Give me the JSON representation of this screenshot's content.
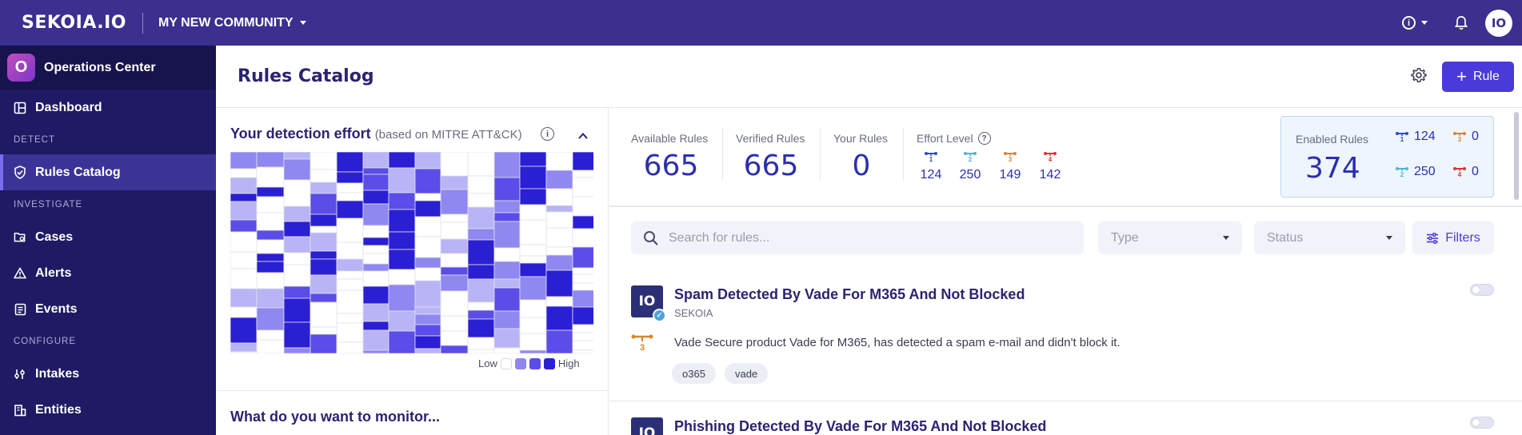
{
  "topbar": {
    "brand": "SEKOIA.IO",
    "community": "MY NEW COMMUNITY",
    "avatar_initials": "IO"
  },
  "sidebar": {
    "app_name": "Operations Center",
    "app_logo_letter": "O",
    "dashboard": "Dashboard",
    "section_detect": "DETECT",
    "rules_catalog": "Rules Catalog",
    "section_investigate": "INVESTIGATE",
    "cases": "Cases",
    "alerts": "Alerts",
    "events": "Events",
    "section_configure": "CONFIGURE",
    "intakes": "Intakes",
    "entities": "Entities"
  },
  "header": {
    "title": "Rules Catalog",
    "add_rule_label": "Rule"
  },
  "effort_panel": {
    "title": "Your detection effort",
    "subtitle": "(based on MITRE ATT&CK)",
    "legend_low": "Low",
    "legend_high": "High",
    "legend_colors": [
      "#ffffff",
      "#8f88f0",
      "#5a4de8",
      "#2a1fd3"
    ],
    "monitor_title": "What do you want to monitor..."
  },
  "stats": {
    "available_label": "Available Rules",
    "available_value": "665",
    "verified_label": "Verified Rules",
    "verified_value": "665",
    "your_label": "Your Rules",
    "your_value": "0",
    "effort_label": "Effort Level",
    "effort_levels": [
      {
        "level": "1",
        "count": "124",
        "color": "#2f4fb8"
      },
      {
        "level": "2",
        "count": "250",
        "color": "#4fb3d9"
      },
      {
        "level": "3",
        "count": "149",
        "color": "#d9862e"
      },
      {
        "level": "4",
        "count": "142",
        "color": "#d93636"
      }
    ],
    "enabled_label": "Enabled Rules",
    "enabled_value": "374",
    "enabled_breakdown": {
      "l1": "124",
      "l3": "0",
      "l2": "250",
      "l4": "0"
    }
  },
  "filters": {
    "search_placeholder": "Search for rules...",
    "type_placeholder": "Type",
    "status_placeholder": "Status",
    "filters_label": "Filters"
  },
  "rules": [
    {
      "name": "Spam Detected By Vade For M365 And Not Blocked",
      "vendor": "SEKOIA",
      "effort": "3",
      "description": "Vade Secure product Vade for M365, has detected a spam e-mail and didn't block it.",
      "tags": [
        "o365",
        "vade"
      ],
      "enabled": false
    },
    {
      "name": "Phishing Detected By Vade For M365 And Not Blocked",
      "enabled": false
    }
  ]
}
